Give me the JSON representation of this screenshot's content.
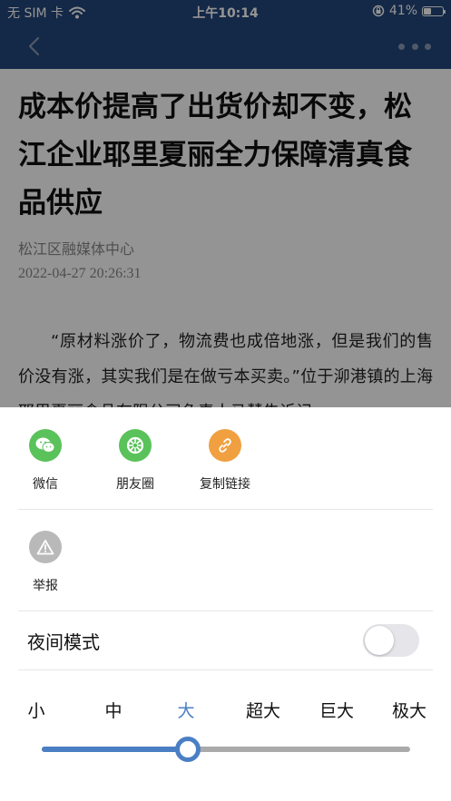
{
  "status_bar": {
    "carrier": "无 SIM 卡",
    "time": "上午10:14",
    "battery": "41%",
    "battery_level": 0.41,
    "icons": [
      "wifi-icon",
      "orientation-lock-icon",
      "battery-icon"
    ]
  },
  "nav": {
    "icons": [
      "back-icon",
      "more-icon"
    ],
    "color": "#24467a"
  },
  "article": {
    "title": "成本价提高了出货价却不变，松江企业耶里夏丽全力保障清真食品供应",
    "source": "松江区融媒体中心",
    "date": "2022-04-27 20:26:31",
    "body": "“原材料涨价了，物流费也成倍地涨，但是我们的售价没有涨，其实我们是在做亏本买卖。”位于泖港镇的上海耶里夏丽食品有限公司负责人马慧告诉记"
  },
  "share_sheet": {
    "items": [
      {
        "label": "微信",
        "icon": "wechat-icon",
        "color": "#5ac25a"
      },
      {
        "label": "朋友圈",
        "icon": "moments-icon",
        "color": "#5ac25a"
      },
      {
        "label": "复制链接",
        "icon": "link-icon",
        "color": "#f0a040"
      }
    ],
    "report": {
      "label": "举报",
      "icon": "warning-icon",
      "color": "#b9b9b9"
    },
    "night_mode": {
      "label": "夜间模式",
      "enabled": false
    },
    "font_sizes": [
      "小",
      "中",
      "大",
      "超大",
      "巨大",
      "极大"
    ],
    "selected_font_size": "大",
    "selected_index": 2,
    "accent": "#4a7fc4"
  }
}
